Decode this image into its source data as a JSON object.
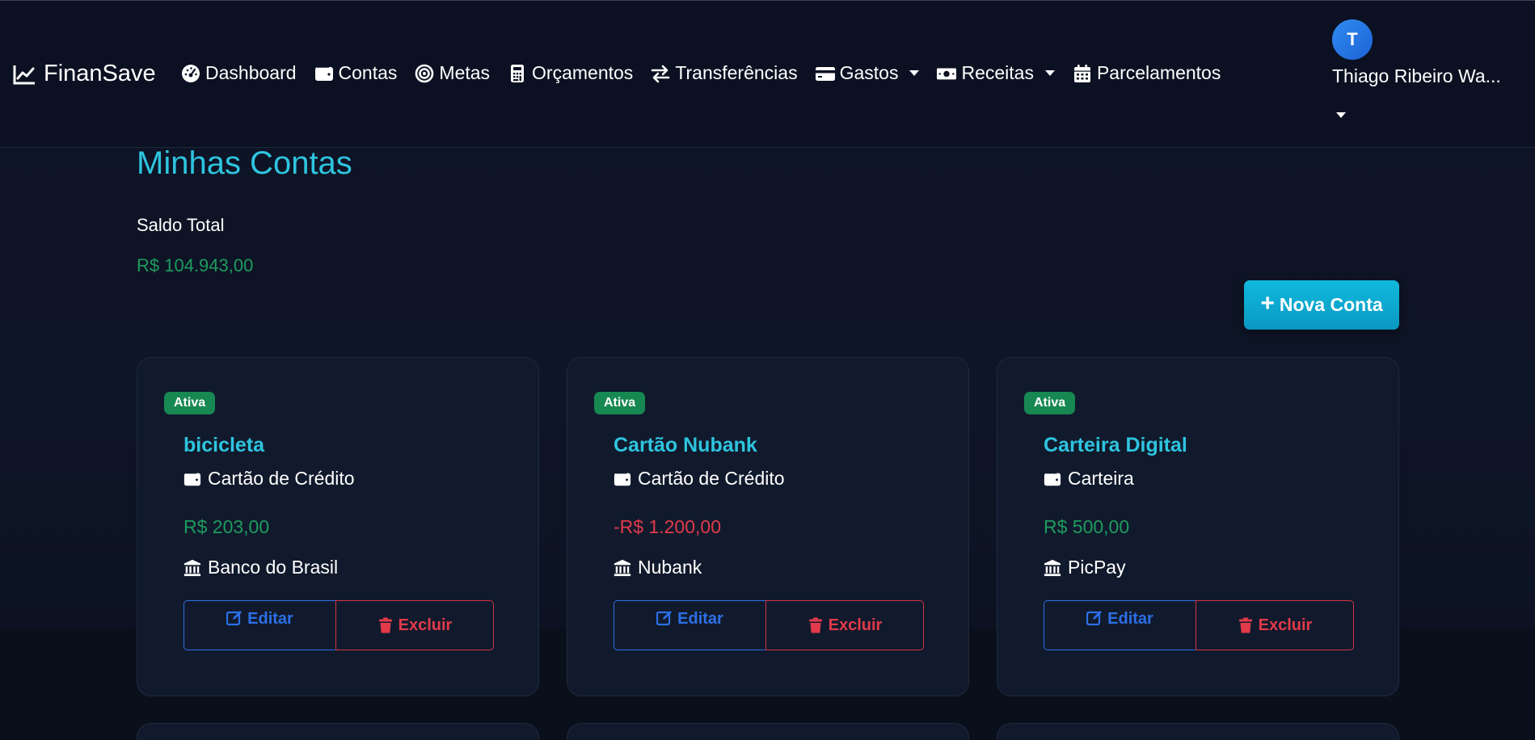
{
  "app": {
    "brand": "FinanSave"
  },
  "nav": {
    "items": [
      {
        "label": "Dashboard",
        "icon": "dashboard-gauge-icon",
        "dropdown": false
      },
      {
        "label": "Contas",
        "icon": "wallet-icon",
        "dropdown": false
      },
      {
        "label": "Metas",
        "icon": "target-icon",
        "dropdown": false
      },
      {
        "label": "Orçamentos",
        "icon": "calculator-icon",
        "dropdown": false
      },
      {
        "label": "Transferências",
        "icon": "exchange-arrows-icon",
        "dropdown": false
      },
      {
        "label": "Gastos",
        "icon": "credit-card-icon",
        "dropdown": true
      },
      {
        "label": "Receitas",
        "icon": "money-bill-icon",
        "dropdown": true
      },
      {
        "label": "Parcelamentos",
        "icon": "calendar-icon",
        "dropdown": false
      }
    ]
  },
  "user": {
    "initial": "T",
    "name": "Thiago Ribeiro Wa..."
  },
  "page": {
    "title": "Minhas Contas",
    "total_label": "Saldo Total",
    "total_value": "R$ 104.943,00",
    "new_account_label": "Nova Conta"
  },
  "accounts": [
    {
      "status": "Ativa",
      "name": "bicicleta",
      "type": "Cartão de Crédito",
      "balance": "R$ 203,00",
      "balance_sign": "positive",
      "bank": "Banco do Brasil",
      "edit_label": "Editar",
      "delete_label": "Excluir"
    },
    {
      "status": "Ativa",
      "name": "Cartão Nubank",
      "type": "Cartão de Crédito",
      "balance": "-R$ 1.200,00",
      "balance_sign": "negative",
      "bank": "Nubank",
      "edit_label": "Editar",
      "delete_label": "Excluir"
    },
    {
      "status": "Ativa",
      "name": "Carteira Digital",
      "type": "Carteira",
      "balance": "R$ 500,00",
      "balance_sign": "positive",
      "bank": "PicPay",
      "edit_label": "Editar",
      "delete_label": "Excluir"
    }
  ],
  "colors": {
    "accent": "#2ec4df",
    "positive": "#1e9b5e",
    "negative": "#e23a4b",
    "edit": "#2c6fe8",
    "badge": "#178852"
  }
}
